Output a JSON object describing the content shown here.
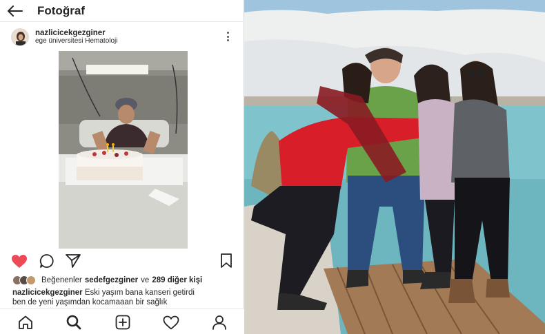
{
  "topbar": {
    "title": "Fotoğraf"
  },
  "post": {
    "username": "nazlicicekgezginer",
    "location": "ege üniversitesi Hematoloji"
  },
  "likes": {
    "prefix": "Beğenenler",
    "first_liker": "sedefgezginer",
    "connector": "ve",
    "others": "289 diğer kişi"
  },
  "caption": {
    "username": "nazlicicekgezginer",
    "line1": "Eski yaşım bana kanseri getirdi",
    "line2": "ben de yeni yaşımdan kocamaaan bir sağlık"
  },
  "icons": {
    "back": "arrow-left-icon",
    "more": "vertical-dots-icon",
    "like": "heart-filled-icon",
    "comment": "speech-bubble-icon",
    "share": "paper-plane-icon",
    "save": "bookmark-icon",
    "home": "home-icon",
    "search": "search-icon",
    "add": "add-square-icon",
    "activity": "heart-outline-icon",
    "profile": "person-icon"
  },
  "colors": {
    "like_red": "#ed4956",
    "text": "#262626"
  }
}
